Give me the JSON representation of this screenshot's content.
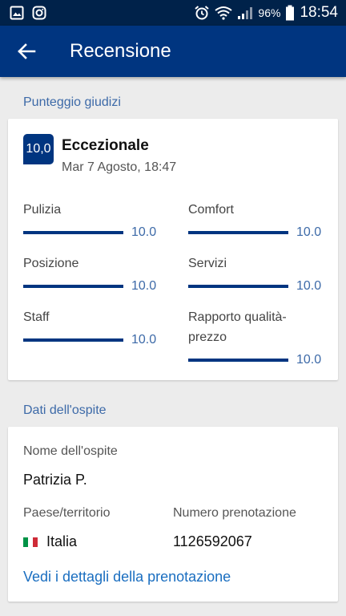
{
  "status_bar": {
    "battery": "96%",
    "time": "18:54",
    "icons": [
      "image-icon",
      "instagram-icon",
      "alarm-icon",
      "wifi-icon",
      "signal-icon",
      "battery-icon"
    ]
  },
  "app_bar": {
    "title": "Recensione",
    "back_icon": "arrow-left-icon"
  },
  "scores_section": {
    "label": "Punteggio giudizi",
    "overall": {
      "score": "10,0",
      "word": "Eccezionale",
      "date": "Mar 7 Agosto, 18:47"
    },
    "ratings": [
      {
        "label": "Pulizia",
        "value": "10.0",
        "fraction": 1.0
      },
      {
        "label": "Comfort",
        "value": "10.0",
        "fraction": 1.0
      },
      {
        "label": "Posizione",
        "value": "10.0",
        "fraction": 1.0
      },
      {
        "label": "Servizi",
        "value": "10.0",
        "fraction": 1.0
      },
      {
        "label": "Staff",
        "value": "10.0",
        "fraction": 1.0
      },
      {
        "label": "Rapporto qualità-prezzo",
        "value": "10.0",
        "fraction": 1.0
      }
    ]
  },
  "guest_section": {
    "label": "Dati dell'ospite",
    "name_label": "Nome dell'ospite",
    "name_value": "Patrizia P.",
    "country_label": "Paese/territorio",
    "country_value": "Italia",
    "country_flag_colors": [
      "#009246",
      "#ffffff",
      "#ce2b37"
    ],
    "booking_label": "Numero prenotazione",
    "booking_value": "1126592067",
    "details_link": "Vedi i dettagli della prenotazione"
  },
  "colors": {
    "brand": "#003580",
    "status_bar": "#00224a",
    "accent_text": "#3d6aa8",
    "link": "#1a6ec0"
  }
}
